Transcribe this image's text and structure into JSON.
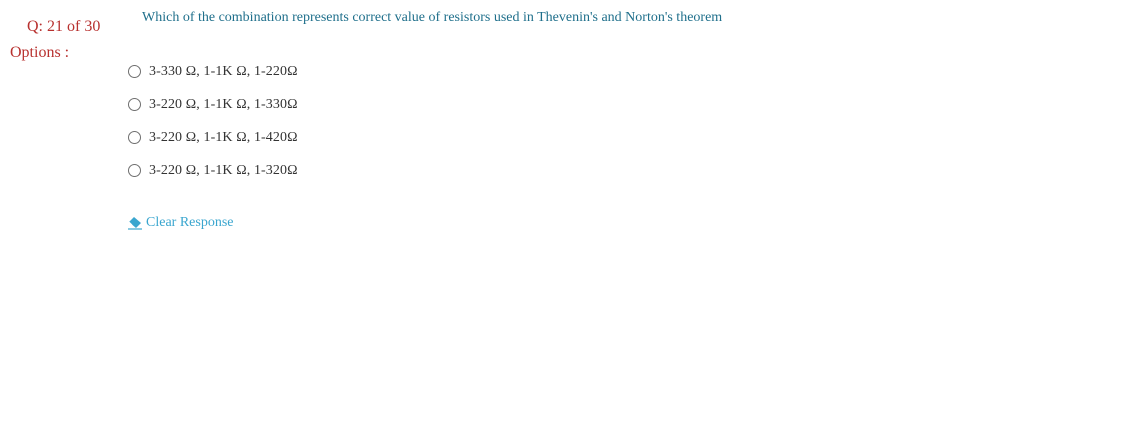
{
  "question": {
    "number_label": "Q: 21 of 30",
    "options_label": "Options :",
    "text": "Which of the combination represents correct value of resistors used in Thevenin's and Norton's theorem"
  },
  "options": [
    {
      "label": "3-330 Ω, 1-1K Ω, 1-220Ω",
      "selected": false
    },
    {
      "label": "3-220 Ω, 1-1K Ω, 1-330Ω",
      "selected": false
    },
    {
      "label": "3-220 Ω, 1-1K Ω, 1-420Ω",
      "selected": false
    },
    {
      "label": "3-220 Ω, 1-1K Ω, 1-320Ω",
      "selected": false
    }
  ],
  "clear_response": {
    "label": "Clear Response",
    "icon": "eraser-icon"
  },
  "colors": {
    "question_number": "#b8312f",
    "question_text": "#1f6f8b",
    "link": "#3aa6cf",
    "option_text": "#333333"
  }
}
